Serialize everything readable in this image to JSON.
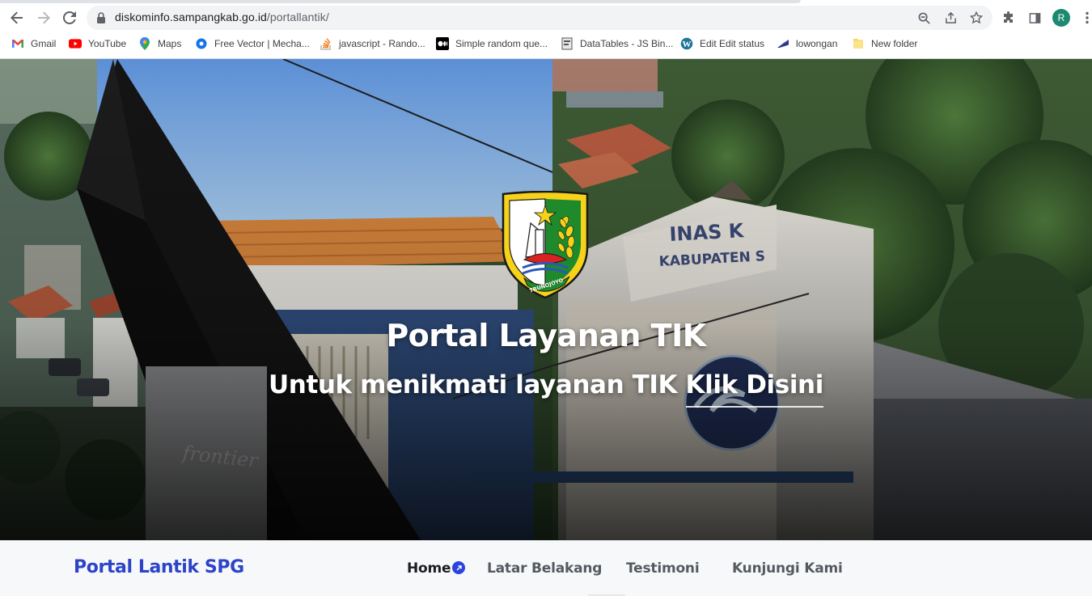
{
  "browser": {
    "url_host": "diskominfo.sampangkab.go.id",
    "url_path": "/portallantik/",
    "profile_initial": "R",
    "icons": {
      "back": "arrow-left-icon",
      "forward": "arrow-right-icon",
      "reload": "reload-icon",
      "zoom": "magnify-icon",
      "share": "share-icon",
      "bookmark": "star-icon",
      "extensions": "puzzle-icon",
      "sidepanel": "sidepanel-icon",
      "menu": "kebab-menu-icon"
    }
  },
  "bookmarks": [
    {
      "label": "Gmail",
      "icon": "gmail-icon"
    },
    {
      "label": "YouTube",
      "icon": "youtube-icon"
    },
    {
      "label": "Maps",
      "icon": "maps-icon"
    },
    {
      "label": "Free Vector | Mecha...",
      "icon": "freepik-icon"
    },
    {
      "label": "javascript - Rando...",
      "icon": "stackoverflow-icon"
    },
    {
      "label": "Simple random que...",
      "icon": "medium-icon"
    },
    {
      "label": "DataTables - JS Bin...",
      "icon": "jsbin-icon"
    },
    {
      "label": "Edit Edit status",
      "icon": "wordpress-icon"
    },
    {
      "label": "lowongan",
      "icon": "flag-icon"
    },
    {
      "label": "New folder",
      "icon": "folder-icon"
    }
  ],
  "hero": {
    "title": "Portal Layanan TIK",
    "subtitle_prefix": "Untuk menikmati layanan TIK ",
    "cta_label": "Klik Disini",
    "emblem_text": "TRUNOJOYO"
  },
  "navbar": {
    "brand": "Portal Lantik SPG",
    "links": [
      {
        "label": "Home",
        "active": true
      },
      {
        "label": "Latar Belakang",
        "active": false
      },
      {
        "label": "Testimoni",
        "active": false
      },
      {
        "label": "Kunjungi Kami",
        "active": false
      }
    ]
  },
  "colors": {
    "brand": "#2d43c8",
    "nav_active": "#1b1e22",
    "nav_inactive": "#555a60",
    "navbar_bg": "#f7f8fa"
  }
}
